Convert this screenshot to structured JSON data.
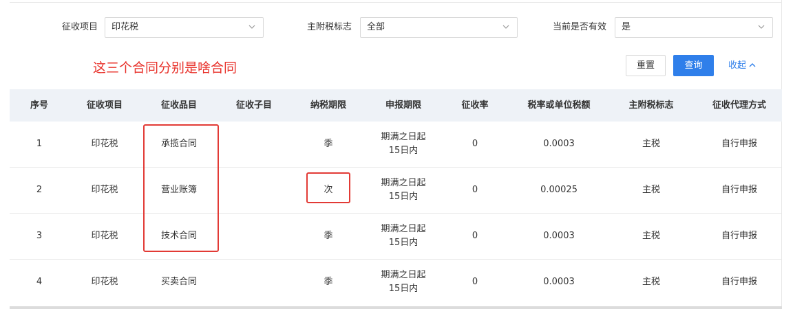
{
  "filters": {
    "item": {
      "label": "征收项目",
      "value": "印花税"
    },
    "main_flag": {
      "label": "主附税标志",
      "value": "全部"
    },
    "valid": {
      "label": "当前是否有效",
      "value": "是"
    }
  },
  "annotation": "这三个合同分别是啥合同",
  "buttons": {
    "reset": "重置",
    "query": "查询",
    "collapse": "收起"
  },
  "colors": {
    "accent": "#2f7fea",
    "annotation_red": "#e23a35",
    "header_bg": "#eef2f7"
  },
  "table": {
    "headers": [
      "序号",
      "征收项目",
      "征收品目",
      "征收子目",
      "纳税期限",
      "申报期限",
      "征收率",
      "税率或单位税额",
      "主附税标志",
      "征收代理方式"
    ],
    "rows": [
      {
        "no": "1",
        "item": "印花税",
        "category": "承揽合同",
        "subitem": "",
        "period": "季",
        "deadline_1": "期满之日起",
        "deadline_2": "15日内",
        "rate": "0",
        "tax_rate": "0.0003",
        "flag": "主税",
        "agent": "自行申报"
      },
      {
        "no": "2",
        "item": "印花税",
        "category": "营业账簿",
        "subitem": "",
        "period": "次",
        "deadline_1": "期满之日起",
        "deadline_2": "15日内",
        "rate": "0",
        "tax_rate": "0.00025",
        "flag": "主税",
        "agent": "自行申报"
      },
      {
        "no": "3",
        "item": "印花税",
        "category": "技术合同",
        "subitem": "",
        "period": "季",
        "deadline_1": "期满之日起",
        "deadline_2": "15日内",
        "rate": "0",
        "tax_rate": "0.0003",
        "flag": "主税",
        "agent": "自行申报"
      },
      {
        "no": "4",
        "item": "印花税",
        "category": "买卖合同",
        "subitem": "",
        "period": "季",
        "deadline_1": "期满之日起",
        "deadline_2": "15日内",
        "rate": "0",
        "tax_rate": "0.0003",
        "flag": "主税",
        "agent": "自行申报"
      }
    ]
  }
}
